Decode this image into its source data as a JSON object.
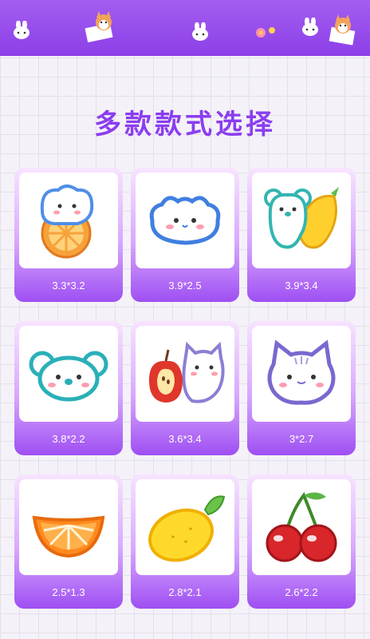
{
  "title": "多款款式选择",
  "colors": {
    "accent": "#8b3df0",
    "banner": "#9a4ef0"
  },
  "patches": [
    {
      "size": "3.3*3.2",
      "icon": "blue-bear-orange-patch-icon"
    },
    {
      "size": "3.9*2.5",
      "icon": "blue-puppy-face-patch-icon"
    },
    {
      "size": "3.9*3.4",
      "icon": "teal-koala-mango-patch-icon"
    },
    {
      "size": "3.8*2.2",
      "icon": "teal-koala-face-patch-icon"
    },
    {
      "size": "3.6*3.4",
      "icon": "cat-with-apple-patch-icon"
    },
    {
      "size": "3*2.7",
      "icon": "purple-cat-face-patch-icon"
    },
    {
      "size": "2.5*1.3",
      "icon": "orange-slice-patch-icon"
    },
    {
      "size": "2.8*2.1",
      "icon": "lemon-patch-icon"
    },
    {
      "size": "2.6*2.2",
      "icon": "cherries-patch-icon"
    }
  ]
}
